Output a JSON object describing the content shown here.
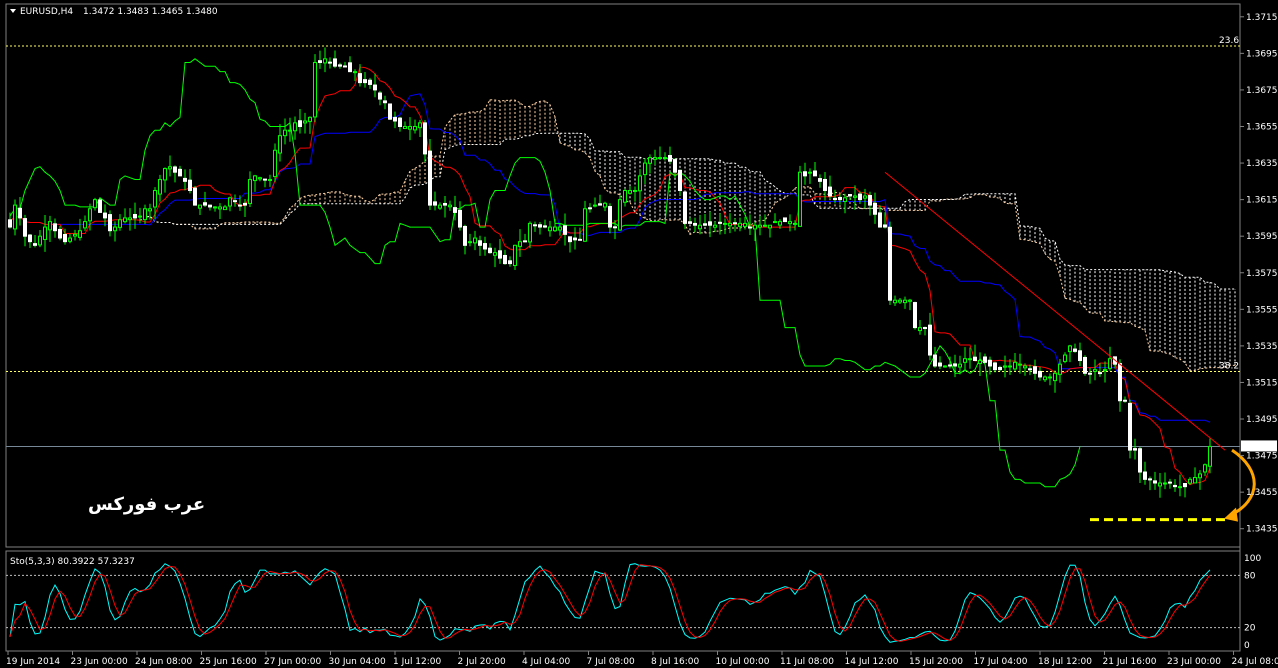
{
  "header": {
    "symbol_label": "EURUSD,H4",
    "ohlc_label": "1.3472 1.3483 1.3465 1.3480"
  },
  "watermark": "عرب فوركس",
  "indicator": {
    "label": "Sto(5,3,3) 80.3922 57.3237",
    "levels": [
      100,
      80,
      20,
      0
    ]
  },
  "colors": {
    "background": "#000000",
    "bull": "#ffffff",
    "bear": "#ffffff",
    "tenkan": "#ff0000",
    "kijun": "#0000ff",
    "chikou": "#00ff00",
    "kumo_a": "#ffd3a6",
    "kumo_b": "#ffffff",
    "fib": "#ffff66",
    "trendline": "#ff0000",
    "annotation": "#ffa500",
    "stoch_main": "#00ffff",
    "stoch_signal": "#ff0000"
  },
  "chart_data": {
    "type": "candlestick",
    "symbol": "EURUSD",
    "timeframe": "H4",
    "price_axis": {
      "min": 1.3425,
      "max": 1.3722,
      "ticks": [
        "1.3715",
        "1.3695",
        "1.3675",
        "1.3655",
        "1.3635",
        "1.3615",
        "1.3595",
        "1.3575",
        "1.3555",
        "1.3535",
        "1.3515",
        "1.3495",
        "1.3475",
        "1.3455",
        "1.3435"
      ]
    },
    "current_price": "1.3480",
    "time_labels": [
      "19 Jun 2014",
      "23 Jun 00:00",
      "24 Jun 08:00",
      "25 Jun 16:00",
      "27 Jun 00:00",
      "30 Jun 04:00",
      "1 Jul 12:00",
      "2 Jul 20:00",
      "4 Jul 04:00",
      "7 Jul 08:00",
      "8 Jul 16:00",
      "10 Jul 00:00",
      "11 Jul 08:00",
      "14 Jul 12:00",
      "15 Jul 20:00",
      "17 Jul 04:00",
      "18 Jul 12:00",
      "21 Jul 16:00",
      "23 Jul 00:00",
      "24 Jul 08:00"
    ],
    "fib_levels": [
      {
        "label": "23.6",
        "price": 1.3699
      },
      {
        "label": "38.2",
        "price": 1.3521
      }
    ],
    "trendline": [
      {
        "bar": 175,
        "price": 1.363
      },
      {
        "bar": 243,
        "price": 1.3478
      }
    ],
    "support_line": {
      "price": 1.344,
      "from_bar": 216,
      "to_bar": 243
    },
    "close_path": [
      1.36,
      1.3612,
      1.3605,
      1.3595,
      1.3592,
      1.359,
      1.3595,
      1.36,
      1.3603,
      1.3598,
      1.3594,
      1.3592,
      1.3594,
      1.3596,
      1.3598,
      1.3603,
      1.361,
      1.3615,
      1.3608,
      1.3605,
      1.3598,
      1.36,
      1.3604,
      1.3605,
      1.3605,
      1.3605,
      1.3606,
      1.361,
      1.361,
      1.362,
      1.3626,
      1.3632,
      1.3633,
      1.363,
      1.3628,
      1.3625,
      1.362,
      1.3612,
      1.3612,
      1.3612,
      1.3611,
      1.3611,
      1.3611,
      1.3611,
      1.3616,
      1.3614,
      1.3612,
      1.3612,
      1.3626,
      1.3628,
      1.3627,
      1.3626,
      1.3626,
      1.3642,
      1.365,
      1.3653,
      1.3653,
      1.3657,
      1.3655,
      1.3658,
      1.366,
      1.369,
      1.369,
      1.3692,
      1.369,
      1.3688,
      1.3688,
      1.3688,
      1.3685,
      1.3685,
      1.3679,
      1.3679,
      1.3678,
      1.3675,
      1.367,
      1.3668,
      1.3659,
      1.3658,
      1.3655,
      1.3655,
      1.3655,
      1.3655,
      1.3657,
      1.364,
      1.3612,
      1.3612,
      1.3612,
      1.3612,
      1.3612,
      1.3608,
      1.36,
      1.359,
      1.3592,
      1.3594,
      1.359,
      1.3588,
      1.3586,
      1.3586,
      1.3583,
      1.358,
      1.358,
      1.359,
      1.3592,
      1.3592,
      1.3602,
      1.3601,
      1.36,
      1.36,
      1.36,
      1.36,
      1.36,
      1.3596,
      1.3592,
      1.3593,
      1.3593,
      1.361,
      1.361,
      1.3612,
      1.3612,
      1.3613,
      1.36,
      1.36,
      1.3615,
      1.362,
      1.362,
      1.362,
      1.3628,
      1.3635,
      1.3638,
      1.3638,
      1.3638,
      1.3638,
      1.3636,
      1.363,
      1.362,
      1.3602,
      1.3602,
      1.3601,
      1.3601,
      1.3601,
      1.3601,
      1.3601,
      1.3602,
      1.3602,
      1.3602,
      1.3602,
      1.3602,
      1.3602,
      1.36,
      1.3601,
      1.3601,
      1.3601,
      1.3601,
      1.3603,
      1.3603,
      1.3603,
      1.3603,
      1.3602,
      1.363,
      1.3628,
      1.363,
      1.3628,
      1.3625,
      1.362,
      1.3617,
      1.3615,
      1.3615,
      1.3616,
      1.3617,
      1.3617,
      1.3615,
      1.3617,
      1.3612,
      1.3607,
      1.36,
      1.36,
      1.356,
      1.356,
      1.356,
      1.356,
      1.356,
      1.3545,
      1.3545,
      1.3545,
      1.353,
      1.3524,
      1.3524,
      1.3524,
      1.3524,
      1.3524,
      1.3525,
      1.3528,
      1.3528,
      1.3527,
      1.3527,
      1.3526,
      1.3524,
      1.3522,
      1.3522,
      1.3524,
      1.3524,
      1.3526,
      1.3525,
      1.3524,
      1.3522,
      1.352,
      1.3518,
      1.3518,
      1.3518,
      1.352,
      1.3525,
      1.353,
      1.3535,
      1.3532,
      1.3527,
      1.352,
      1.352,
      1.3522,
      1.352,
      1.3522,
      1.3528,
      1.3525,
      1.3505,
      1.3505,
      1.3478,
      1.3478,
      1.3466,
      1.3462,
      1.3462,
      1.346,
      1.346,
      1.346,
      1.346,
      1.3458,
      1.3458,
      1.3458,
      1.3462,
      1.3463,
      1.3465,
      1.347,
      1.348
    ]
  }
}
